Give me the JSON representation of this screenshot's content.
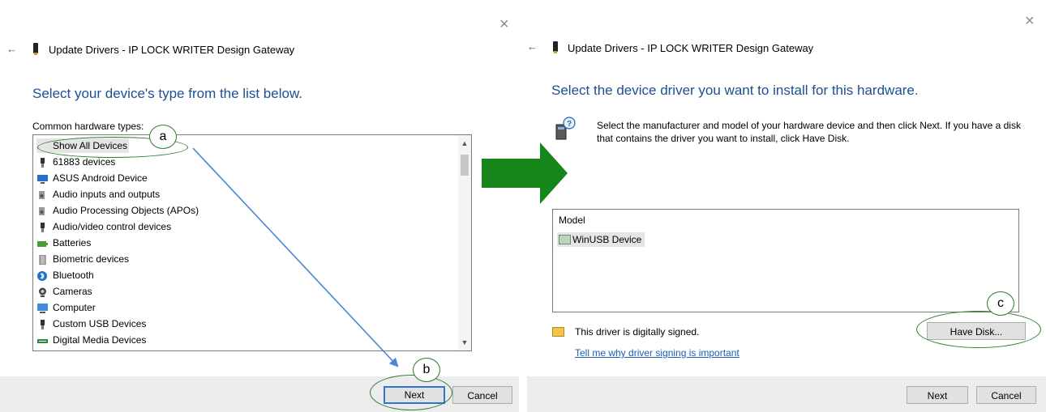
{
  "left_dialog": {
    "window_title": "Update Drivers - IP LOCK WRITER  Design Gateway",
    "heading": "Select your device's type from the list below.",
    "list_label": "Common hardware types:",
    "items": [
      {
        "label": "Show All Devices",
        "icon": "none",
        "selected": true
      },
      {
        "label": "61883 devices",
        "icon": "plug-icon"
      },
      {
        "label": "ASUS Android Device",
        "icon": "monitor-icon"
      },
      {
        "label": "Audio inputs and outputs",
        "icon": "speaker-icon"
      },
      {
        "label": "Audio Processing Objects (APOs)",
        "icon": "speaker-icon"
      },
      {
        "label": "Audio/video control devices",
        "icon": "plug-icon"
      },
      {
        "label": "Batteries",
        "icon": "battery-icon"
      },
      {
        "label": "Biometric devices",
        "icon": "fingerprint-icon"
      },
      {
        "label": "Bluetooth",
        "icon": "bluetooth-icon"
      },
      {
        "label": "Cameras",
        "icon": "camera-icon"
      },
      {
        "label": "Computer",
        "icon": "computer-icon"
      },
      {
        "label": "Custom USB Devices",
        "icon": "plug-icon"
      },
      {
        "label": "Digital Media Devices",
        "icon": "media-icon"
      }
    ],
    "next_label": "Next",
    "cancel_label": "Cancel"
  },
  "right_dialog": {
    "window_title": "Update Drivers - IP LOCK WRITER  Design Gateway",
    "heading": "Select the device driver you want to install for this hardware.",
    "instructions": "Select the manufacturer and model of your hardware device and then click Next. If you have a disk that contains the driver you want to install, click Have Disk.",
    "model_header": "Model",
    "model_item": "WinUSB Device",
    "signed_text": "This driver is digitally signed.",
    "signing_link": "Tell me why driver signing is important",
    "have_disk_label": "Have Disk...",
    "next_label": "Next",
    "cancel_label": "Cancel"
  },
  "annotations": {
    "a": "a",
    "b": "b",
    "c": "c"
  },
  "colors": {
    "heading_blue": "#1d4f91",
    "annotation_green": "#2e7d32",
    "arrow_green": "#17861a",
    "arrow_blue": "#4a86d4",
    "link_blue": "#1a5fb4"
  }
}
